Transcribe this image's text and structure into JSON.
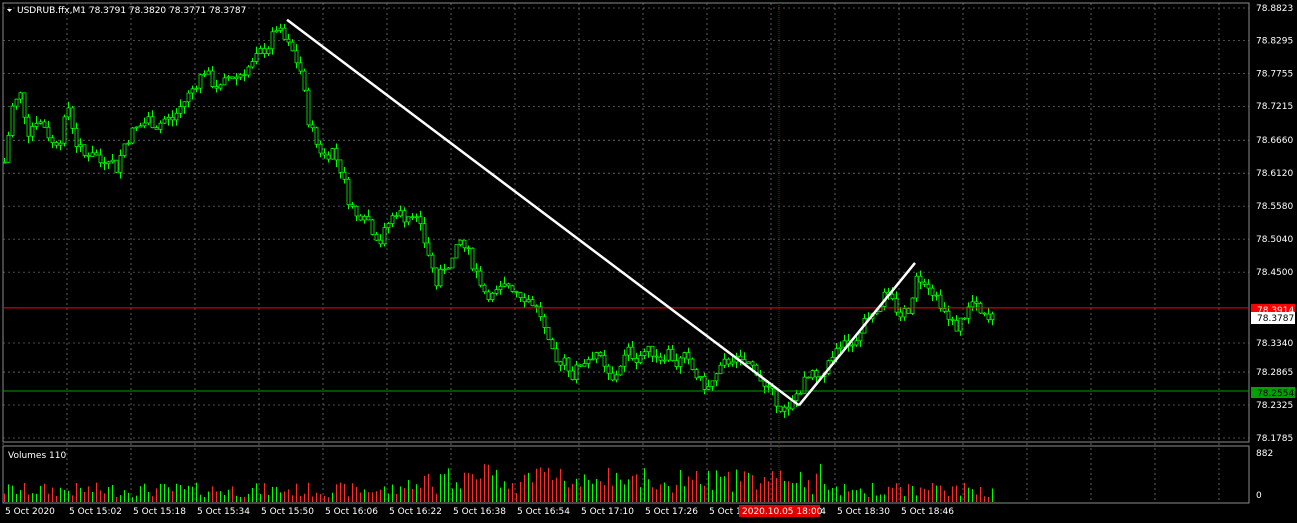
{
  "window": {
    "header_text": "USDRUB.ffx,M1  78.3791 78.3820 78.3771 78.3787",
    "menu_arrow_icon": "triangle-down-icon"
  },
  "colors": {
    "background": "#000000",
    "grid": "#9a9a9a",
    "bull": "#00ff00",
    "bear": "#ff2a2a",
    "trendline": "#ffffff",
    "crosshair": "#c00000",
    "price_line_red": "#ff0000",
    "price_line_green": "#00a000"
  },
  "price_axis": {
    "labels": [
      "78.8823",
      "78.8295",
      "78.7755",
      "78.7215",
      "78.6660",
      "78.6120",
      "78.5580",
      "78.5040",
      "78.4500",
      "78.3340",
      "78.2865",
      "78.2325",
      "78.1785"
    ],
    "current_price": "78.3787",
    "red_label": "78.3914",
    "green_label": "78.2554"
  },
  "time_axis": {
    "labels": [
      "5 Oct 2020",
      "5 Oct 15:02",
      "5 Oct 15:18",
      "5 Oct 15:34",
      "5 Oct 15:50",
      "5 Oct 16:06",
      "5 Oct 16:22",
      "5 Oct 16:38",
      "5 Oct 16:54",
      "5 Oct 17:10",
      "5 Oct 17:26",
      "5 Oct 17",
      "5 Oct 18:14",
      "5 Oct 18:30",
      "5 Oct 18:46"
    ],
    "crosshair_label": "2020.10.05 18:00"
  },
  "volume_panel": {
    "title": "Volumes 110",
    "max_label": "882",
    "min_label": "0"
  },
  "chart_data": {
    "type": "candlestick",
    "symbol": "USDRUB.ffx",
    "timeframe": "M1",
    "ylim": [
      78.1785,
      78.8823
    ],
    "volume_range": [
      0,
      882
    ],
    "trend_lines": [
      {
        "from": {
          "time": "15:52",
          "price": 78.863
        },
        "to": {
          "time": "18:00",
          "price": 78.232
        }
      },
      {
        "from": {
          "time": "18:00",
          "price": 78.232
        },
        "to": {
          "time": "18:29",
          "price": 78.465
        }
      }
    ],
    "horizontal_lines": [
      78.3914,
      78.2554
    ],
    "crosshair_time": "2020.10.05 18:00",
    "close_path": [
      [
        0,
        78.63
      ],
      [
        8,
        78.72
      ],
      [
        16,
        78.74
      ],
      [
        24,
        78.68
      ],
      [
        32,
        78.7
      ],
      [
        40,
        78.69
      ],
      [
        48,
        78.66
      ],
      [
        56,
        78.67
      ],
      [
        64,
        78.72
      ],
      [
        72,
        78.66
      ],
      [
        80,
        78.64
      ],
      [
        88,
        78.65
      ],
      [
        96,
        78.63
      ],
      [
        104,
        78.64
      ],
      [
        112,
        78.62
      ],
      [
        120,
        78.66
      ],
      [
        128,
        78.68
      ],
      [
        136,
        78.69
      ],
      [
        144,
        78.7
      ],
      [
        152,
        78.69
      ],
      [
        160,
        78.7
      ],
      [
        168,
        78.7
      ],
      [
        176,
        78.72
      ],
      [
        184,
        78.74
      ],
      [
        192,
        78.76
      ],
      [
        200,
        78.78
      ],
      [
        208,
        78.76
      ],
      [
        216,
        78.75
      ],
      [
        224,
        78.77
      ],
      [
        232,
        78.77
      ],
      [
        240,
        78.78
      ],
      [
        248,
        78.79
      ],
      [
        256,
        78.81
      ],
      [
        264,
        78.82
      ],
      [
        272,
        78.85
      ],
      [
        280,
        78.83
      ],
      [
        288,
        78.81
      ],
      [
        296,
        78.78
      ],
      [
        304,
        78.7
      ],
      [
        312,
        78.66
      ],
      [
        320,
        78.64
      ],
      [
        328,
        78.65
      ],
      [
        336,
        78.62
      ],
      [
        344,
        78.57
      ],
      [
        352,
        78.54
      ],
      [
        360,
        78.55
      ],
      [
        368,
        78.52
      ],
      [
        376,
        78.5
      ],
      [
        384,
        78.53
      ],
      [
        392,
        78.55
      ],
      [
        400,
        78.54
      ],
      [
        408,
        78.55
      ],
      [
        416,
        78.52
      ],
      [
        424,
        78.48
      ],
      [
        432,
        78.43
      ],
      [
        440,
        78.46
      ],
      [
        448,
        78.47
      ],
      [
        456,
        78.5
      ],
      [
        464,
        78.48
      ],
      [
        472,
        78.45
      ],
      [
        480,
        78.42
      ],
      [
        488,
        78.41
      ],
      [
        496,
        78.42
      ],
      [
        504,
        78.43
      ],
      [
        512,
        78.42
      ],
      [
        520,
        78.41
      ],
      [
        528,
        78.4
      ],
      [
        536,
        78.38
      ],
      [
        544,
        78.33
      ],
      [
        552,
        78.3
      ],
      [
        560,
        78.31
      ],
      [
        568,
        78.28
      ],
      [
        576,
        78.3
      ],
      [
        584,
        78.31
      ],
      [
        592,
        78.32
      ],
      [
        600,
        78.29
      ],
      [
        608,
        78.27
      ],
      [
        616,
        78.3
      ],
      [
        624,
        78.32
      ],
      [
        632,
        78.31
      ],
      [
        640,
        78.32
      ],
      [
        648,
        78.32
      ],
      [
        656,
        78.31
      ],
      [
        664,
        78.32
      ],
      [
        672,
        78.3
      ],
      [
        680,
        78.31
      ],
      [
        688,
        78.29
      ],
      [
        696,
        78.27
      ],
      [
        704,
        78.26
      ],
      [
        712,
        78.28
      ],
      [
        720,
        78.3
      ],
      [
        728,
        78.31
      ],
      [
        736,
        78.3
      ],
      [
        744,
        78.3
      ],
      [
        752,
        78.29
      ],
      [
        760,
        78.26
      ],
      [
        768,
        78.25
      ],
      [
        776,
        78.23
      ],
      [
        784,
        78.22
      ],
      [
        792,
        78.25
      ],
      [
        800,
        78.27
      ],
      [
        808,
        78.28
      ],
      [
        816,
        78.27
      ],
      [
        824,
        78.3
      ],
      [
        832,
        78.33
      ],
      [
        840,
        78.34
      ],
      [
        848,
        78.33
      ],
      [
        856,
        78.36
      ],
      [
        864,
        78.38
      ],
      [
        872,
        78.39
      ],
      [
        880,
        78.41
      ],
      [
        888,
        78.4
      ],
      [
        896,
        78.38
      ],
      [
        904,
        78.39
      ],
      [
        912,
        78.44
      ],
      [
        920,
        78.44
      ],
      [
        928,
        78.42
      ],
      [
        936,
        78.4
      ],
      [
        944,
        78.37
      ],
      [
        952,
        78.36
      ],
      [
        960,
        78.38
      ],
      [
        968,
        78.4
      ],
      [
        976,
        78.38
      ],
      [
        984,
        78.37
      ],
      [
        992,
        78.38
      ]
    ]
  }
}
